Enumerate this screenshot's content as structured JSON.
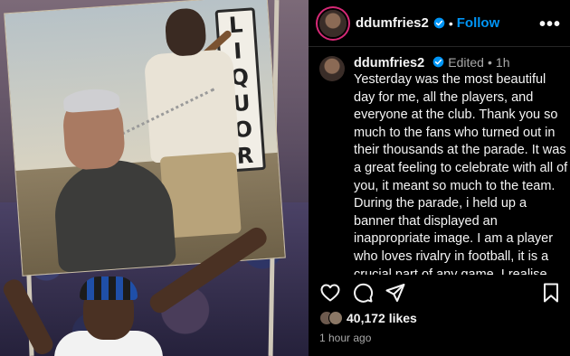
{
  "post": {
    "username": "ddumfries2",
    "follow_label": "Follow",
    "header_separator": "•",
    "more_label": "•••"
  },
  "image": {
    "sign_letters": [
      "L",
      "I",
      "Q",
      "U",
      "O",
      "R"
    ]
  },
  "caption": {
    "username": "ddumfries2",
    "edited": "Edited",
    "separator": "•",
    "time_short": "1h",
    "text": "Yesterday was the most beautiful day for me, all the players, and everyone at the club. Thank you so much to the fans who turned out in their thousands at the parade. It was a great feeling to celebrate with all of you, it meant so much to the team. During the parade, i held up a banner that displayed an inappropriate image. I am a player who loves rivalry in football, it is a crucial part of any game. I realise that holding up the banner was an error of judgement on my part and not smart at all. Let's move on to focusing on what has been the most"
  },
  "engagement": {
    "likes": "40,172 likes",
    "posted": "1 hour ago"
  },
  "icons": [
    "heart-icon",
    "comment-icon",
    "share-icon",
    "bookmark-icon",
    "verified-icon",
    "more-icon"
  ],
  "colors": {
    "background": "#000000",
    "text": "#f5f5f5",
    "muted": "#a8a8a8",
    "accent": "#0095f6",
    "verified": "#0095f6",
    "story_ring": "#d62976"
  }
}
